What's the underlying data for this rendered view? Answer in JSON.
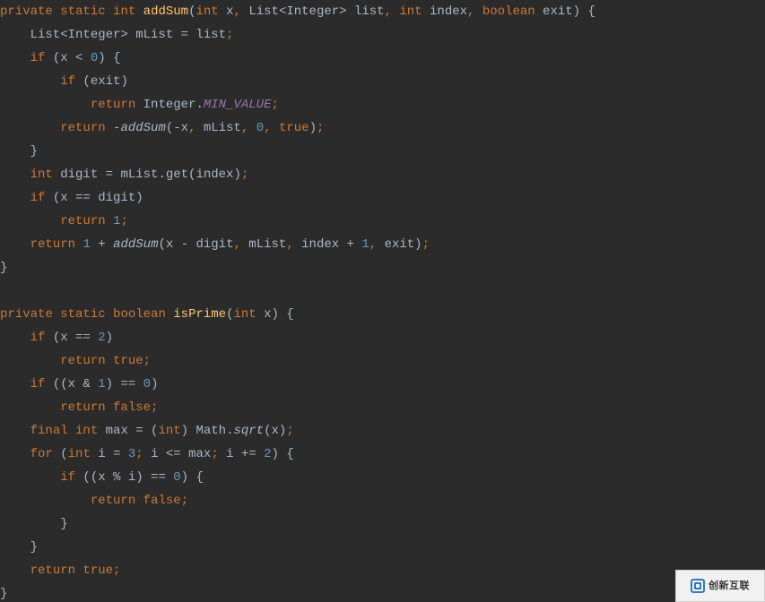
{
  "code": {
    "lines": [
      [
        {
          "cls": "k",
          "t": "private"
        },
        {
          "cls": "d",
          "t": " "
        },
        {
          "cls": "k",
          "t": "static"
        },
        {
          "cls": "d",
          "t": " "
        },
        {
          "cls": "k",
          "t": "int"
        },
        {
          "cls": "d",
          "t": " "
        },
        {
          "cls": "fn",
          "t": "addSum"
        },
        {
          "cls": "d",
          "t": "("
        },
        {
          "cls": "k",
          "t": "int"
        },
        {
          "cls": "d",
          "t": " x"
        },
        {
          "cls": "k",
          "t": ","
        },
        {
          "cls": "d",
          "t": " List<Integer> list"
        },
        {
          "cls": "k",
          "t": ","
        },
        {
          "cls": "d",
          "t": " "
        },
        {
          "cls": "k",
          "t": "int"
        },
        {
          "cls": "d",
          "t": " index"
        },
        {
          "cls": "k",
          "t": ","
        },
        {
          "cls": "d",
          "t": " "
        },
        {
          "cls": "k",
          "t": "boolean"
        },
        {
          "cls": "d",
          "t": " exit) {"
        }
      ],
      [
        {
          "cls": "d",
          "t": "    List<Integer> mList = list"
        },
        {
          "cls": "k",
          "t": ";"
        }
      ],
      [
        {
          "cls": "d",
          "t": "    "
        },
        {
          "cls": "k",
          "t": "if"
        },
        {
          "cls": "d",
          "t": " (x < "
        },
        {
          "cls": "n",
          "t": "0"
        },
        {
          "cls": "d",
          "t": ") {"
        }
      ],
      [
        {
          "cls": "d",
          "t": "        "
        },
        {
          "cls": "k",
          "t": "if"
        },
        {
          "cls": "d",
          "t": " (exit)"
        }
      ],
      [
        {
          "cls": "d",
          "t": "            "
        },
        {
          "cls": "k",
          "t": "return"
        },
        {
          "cls": "d",
          "t": " Integer."
        },
        {
          "cls": "cf",
          "t": "MIN_VALUE"
        },
        {
          "cls": "k",
          "t": ";"
        }
      ],
      [
        {
          "cls": "d",
          "t": "        "
        },
        {
          "cls": "k",
          "t": "return"
        },
        {
          "cls": "d",
          "t": " -"
        },
        {
          "cls": "it",
          "t": "addSum"
        },
        {
          "cls": "d",
          "t": "(-x"
        },
        {
          "cls": "k",
          "t": ","
        },
        {
          "cls": "d",
          "t": " mList"
        },
        {
          "cls": "k",
          "t": ","
        },
        {
          "cls": "d",
          "t": " "
        },
        {
          "cls": "n",
          "t": "0"
        },
        {
          "cls": "k",
          "t": ","
        },
        {
          "cls": "d",
          "t": " "
        },
        {
          "cls": "k",
          "t": "true"
        },
        {
          "cls": "d",
          "t": ")"
        },
        {
          "cls": "k",
          "t": ";"
        }
      ],
      [
        {
          "cls": "d",
          "t": "    }"
        }
      ],
      [
        {
          "cls": "d",
          "t": "    "
        },
        {
          "cls": "k",
          "t": "int"
        },
        {
          "cls": "d",
          "t": " digit = mList.get(index)"
        },
        {
          "cls": "k",
          "t": ";"
        }
      ],
      [
        {
          "cls": "d",
          "t": "    "
        },
        {
          "cls": "k",
          "t": "if"
        },
        {
          "cls": "d",
          "t": " (x == digit)"
        }
      ],
      [
        {
          "cls": "d",
          "t": "        "
        },
        {
          "cls": "k",
          "t": "return"
        },
        {
          "cls": "d",
          "t": " "
        },
        {
          "cls": "n",
          "t": "1"
        },
        {
          "cls": "k",
          "t": ";"
        }
      ],
      [
        {
          "cls": "d",
          "t": "    "
        },
        {
          "cls": "k",
          "t": "return"
        },
        {
          "cls": "d",
          "t": " "
        },
        {
          "cls": "n",
          "t": "1"
        },
        {
          "cls": "d",
          "t": " + "
        },
        {
          "cls": "it",
          "t": "addSum"
        },
        {
          "cls": "d",
          "t": "(x - digit"
        },
        {
          "cls": "k",
          "t": ","
        },
        {
          "cls": "d",
          "t": " mList"
        },
        {
          "cls": "k",
          "t": ","
        },
        {
          "cls": "d",
          "t": " index + "
        },
        {
          "cls": "n",
          "t": "1"
        },
        {
          "cls": "k",
          "t": ","
        },
        {
          "cls": "d",
          "t": " exit)"
        },
        {
          "cls": "k",
          "t": ";"
        }
      ],
      [
        {
          "cls": "d",
          "t": "}"
        }
      ],
      [
        {
          "cls": "d",
          "t": ""
        }
      ],
      [
        {
          "cls": "k",
          "t": "private"
        },
        {
          "cls": "d",
          "t": " "
        },
        {
          "cls": "k",
          "t": "static"
        },
        {
          "cls": "d",
          "t": " "
        },
        {
          "cls": "k",
          "t": "boolean"
        },
        {
          "cls": "d",
          "t": " "
        },
        {
          "cls": "fn",
          "t": "isPrime"
        },
        {
          "cls": "d",
          "t": "("
        },
        {
          "cls": "k",
          "t": "int"
        },
        {
          "cls": "d",
          "t": " x) {"
        }
      ],
      [
        {
          "cls": "d",
          "t": "    "
        },
        {
          "cls": "k",
          "t": "if"
        },
        {
          "cls": "d",
          "t": " (x == "
        },
        {
          "cls": "n",
          "t": "2"
        },
        {
          "cls": "d",
          "t": ")"
        }
      ],
      [
        {
          "cls": "d",
          "t": "        "
        },
        {
          "cls": "k",
          "t": "return true;"
        }
      ],
      [
        {
          "cls": "d",
          "t": "    "
        },
        {
          "cls": "k",
          "t": "if"
        },
        {
          "cls": "d",
          "t": " ((x & "
        },
        {
          "cls": "n",
          "t": "1"
        },
        {
          "cls": "d",
          "t": ") == "
        },
        {
          "cls": "n",
          "t": "0"
        },
        {
          "cls": "d",
          "t": ")"
        }
      ],
      [
        {
          "cls": "d",
          "t": "        "
        },
        {
          "cls": "k",
          "t": "return false;"
        }
      ],
      [
        {
          "cls": "d",
          "t": "    "
        },
        {
          "cls": "k",
          "t": "final int"
        },
        {
          "cls": "d",
          "t": " max = ("
        },
        {
          "cls": "k",
          "t": "int"
        },
        {
          "cls": "d",
          "t": ") Math."
        },
        {
          "cls": "it",
          "t": "sqrt"
        },
        {
          "cls": "d",
          "t": "(x)"
        },
        {
          "cls": "k",
          "t": ";"
        }
      ],
      [
        {
          "cls": "d",
          "t": "    "
        },
        {
          "cls": "k",
          "t": "for"
        },
        {
          "cls": "d",
          "t": " ("
        },
        {
          "cls": "k",
          "t": "int"
        },
        {
          "cls": "d",
          "t": " i = "
        },
        {
          "cls": "n",
          "t": "3"
        },
        {
          "cls": "k",
          "t": ";"
        },
        {
          "cls": "d",
          "t": " i <= max"
        },
        {
          "cls": "k",
          "t": ";"
        },
        {
          "cls": "d",
          "t": " i += "
        },
        {
          "cls": "n",
          "t": "2"
        },
        {
          "cls": "d",
          "t": ") {"
        }
      ],
      [
        {
          "cls": "d",
          "t": "        "
        },
        {
          "cls": "k",
          "t": "if"
        },
        {
          "cls": "d",
          "t": " ((x % i) == "
        },
        {
          "cls": "n",
          "t": "0"
        },
        {
          "cls": "d",
          "t": ") {"
        }
      ],
      [
        {
          "cls": "d",
          "t": "            "
        },
        {
          "cls": "k",
          "t": "return false;"
        }
      ],
      [
        {
          "cls": "d",
          "t": "        }"
        }
      ],
      [
        {
          "cls": "d",
          "t": "    }"
        }
      ],
      [
        {
          "cls": "d",
          "t": "    "
        },
        {
          "cls": "k",
          "t": "return true;"
        }
      ],
      [
        {
          "cls": "d",
          "t": "}"
        }
      ]
    ]
  },
  "watermark": {
    "text": "创新互联"
  }
}
